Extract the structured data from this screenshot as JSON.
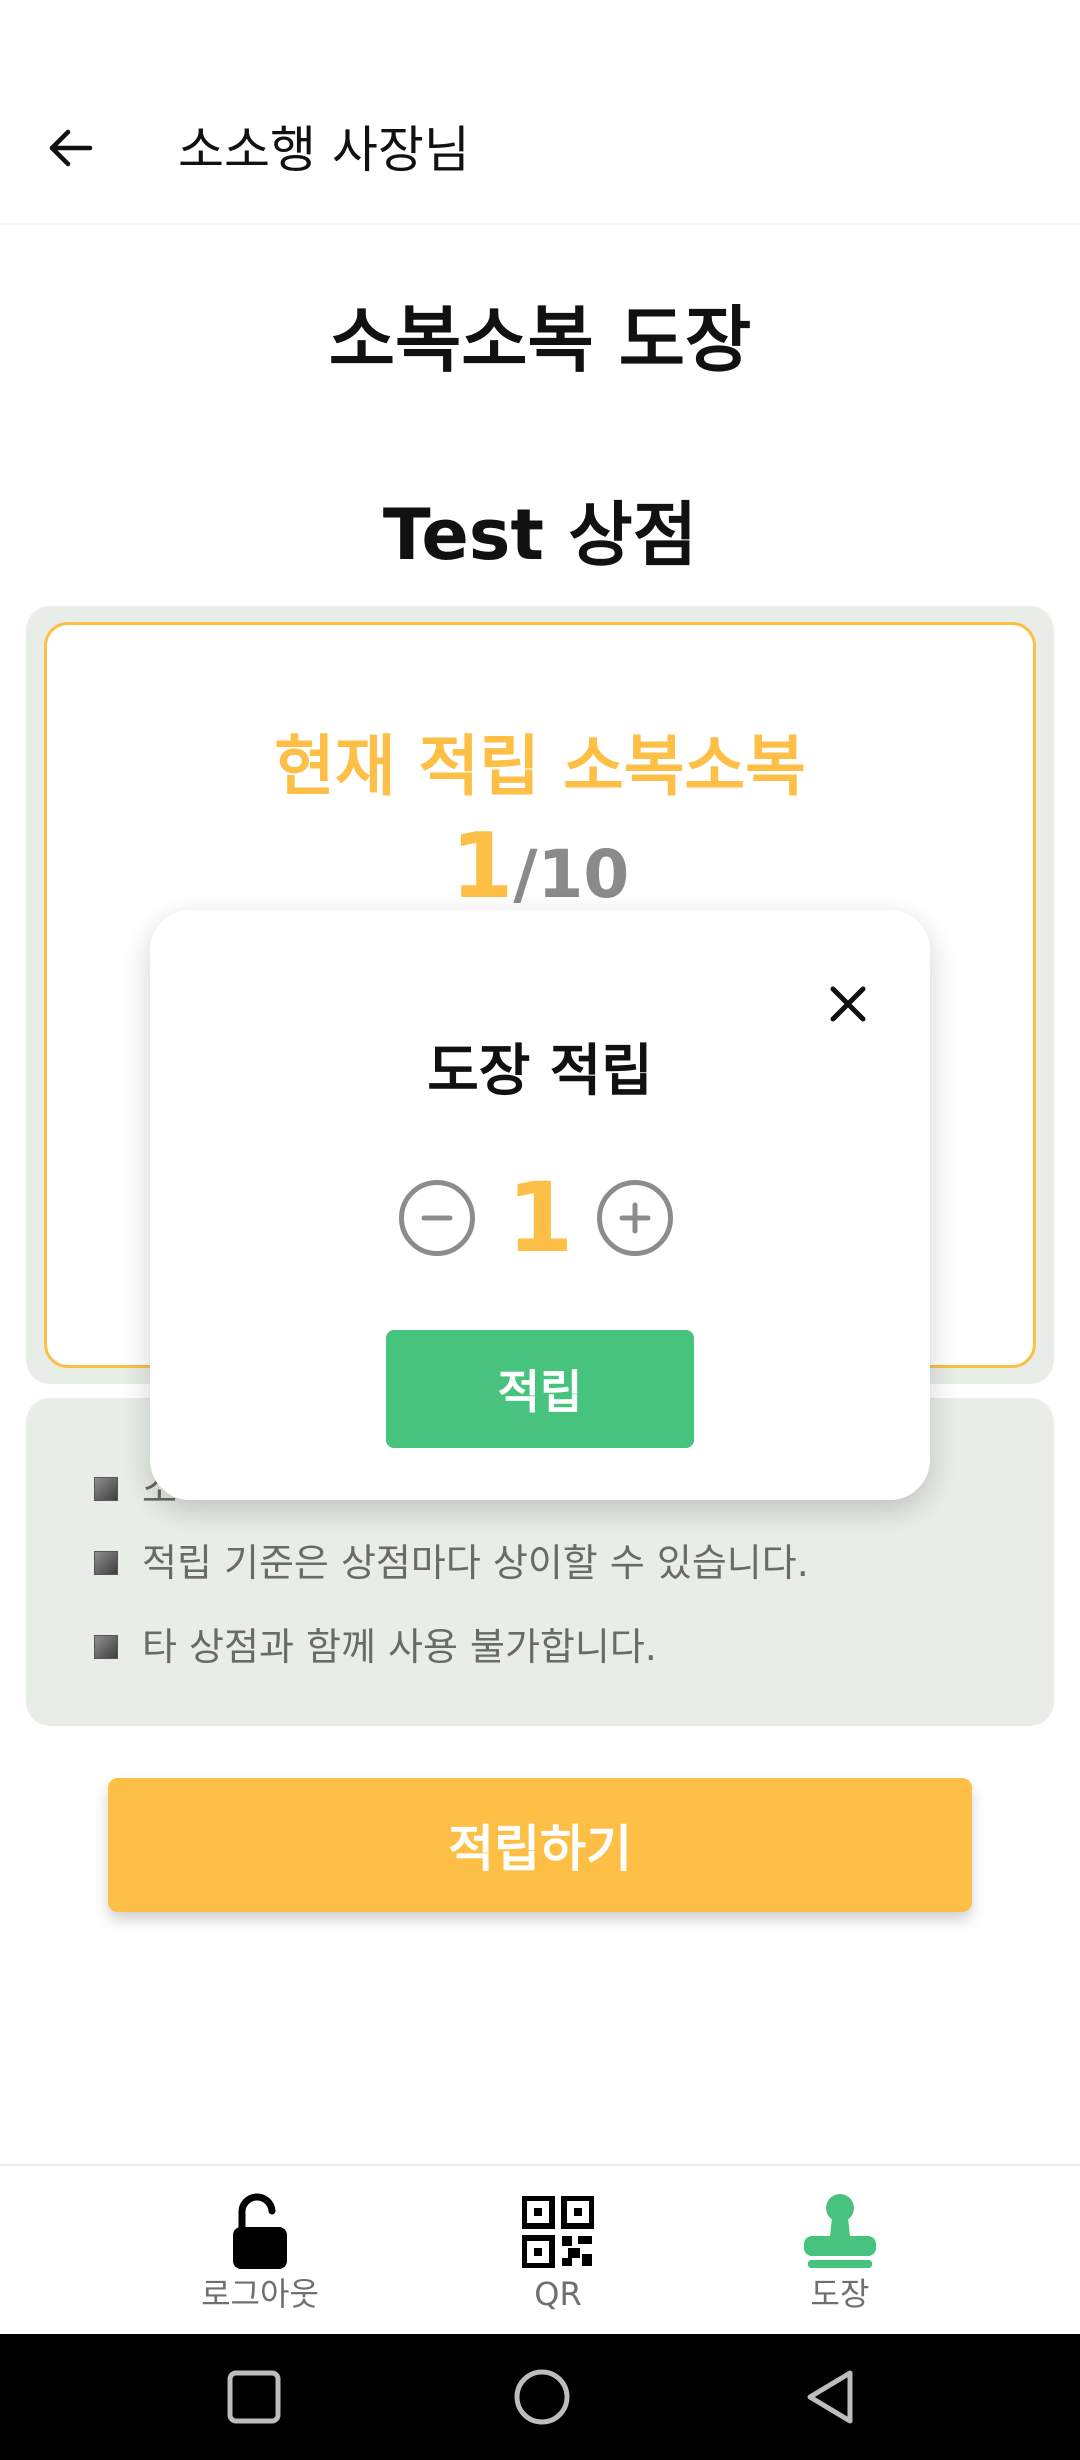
{
  "header": {
    "title": "소소행 사장님"
  },
  "page": {
    "title": "소복소복 도장",
    "store_name": "Test 상점"
  },
  "stamp_card": {
    "label": "현재 적립 소복소복",
    "current": "1",
    "separator": "/",
    "total": "10"
  },
  "modal": {
    "title": "도장 적립",
    "quantity": "1",
    "submit_label": "적립"
  },
  "info": {
    "items": [
      "소",
      "적립 기준은 상점마다 상이할 수 있습니다.",
      "타 상점과 함께 사용 불가합니다."
    ]
  },
  "main_button": {
    "label": "적립하기"
  },
  "nav": {
    "items": [
      {
        "label": "로그아웃",
        "icon": "unlock-icon"
      },
      {
        "label": "QR",
        "icon": "qr-code-icon"
      },
      {
        "label": "도장",
        "icon": "stamp-icon"
      }
    ],
    "active_color": "#47c37d"
  },
  "colors": {
    "accent_yellow": "#fdbf45",
    "accent_green": "#47c37d",
    "panel_bg": "#e9ede8"
  }
}
